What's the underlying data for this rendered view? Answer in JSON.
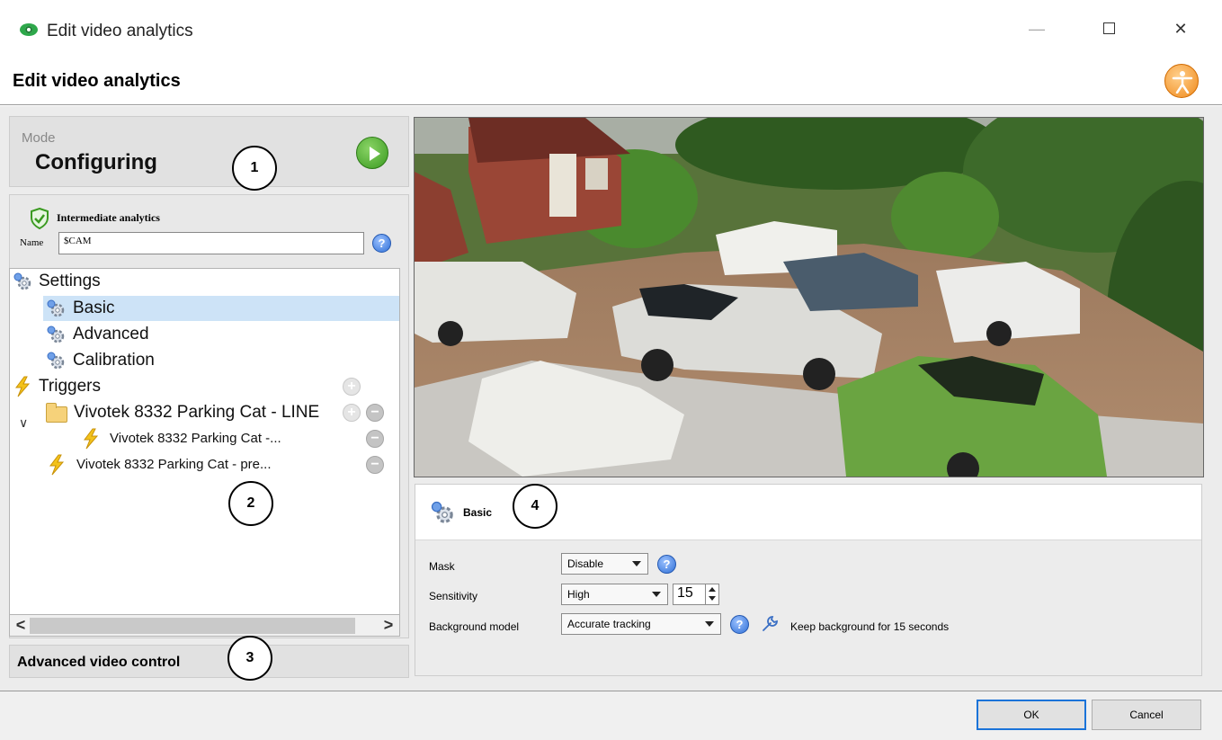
{
  "window": {
    "title": "Edit video analytics",
    "minimize_glyph": "—",
    "close_glyph": "✕"
  },
  "header": {
    "title": "Edit video analytics",
    "icon": "accessibility-icon"
  },
  "mode": {
    "label": "Mode",
    "value": "Configuring",
    "play_icon": "play-icon"
  },
  "analytics": {
    "title": "Intermediate analytics",
    "name_label": "Name",
    "name_value": "$CAM"
  },
  "tree": {
    "settings": "Settings",
    "basic": "Basic",
    "advanced": "Advanced",
    "calibration": "Calibration",
    "triggers": "Triggers",
    "line_group": "Vivotek 8332 Parking Cat - LINE",
    "line_child": "Vivotek 8332 Parking Cat -...",
    "presence": "Vivotek 8332 Parking Cat - pre..."
  },
  "scroll": {
    "left": "<",
    "right": ">"
  },
  "advanced_video_control": "Advanced video control",
  "callouts": [
    "1",
    "2",
    "3",
    "4"
  ],
  "basic_panel": {
    "title": "Basic",
    "mask_label": "Mask",
    "mask_value": "Disable",
    "sensitivity_label": "Sensitivity",
    "sensitivity_value": "High",
    "sensitivity_number": "15",
    "background_label": "Background model",
    "background_value": "Accurate tracking",
    "keep_text": "Keep background for 15 seconds",
    "help_glyph": "?"
  },
  "buttons": {
    "ok": "OK",
    "cancel": "Cancel"
  },
  "colors": {
    "selection": "#cde3f7",
    "ok_border": "#1a73d9",
    "play": "#3a9a20",
    "accessibility": "#f08a1c"
  }
}
